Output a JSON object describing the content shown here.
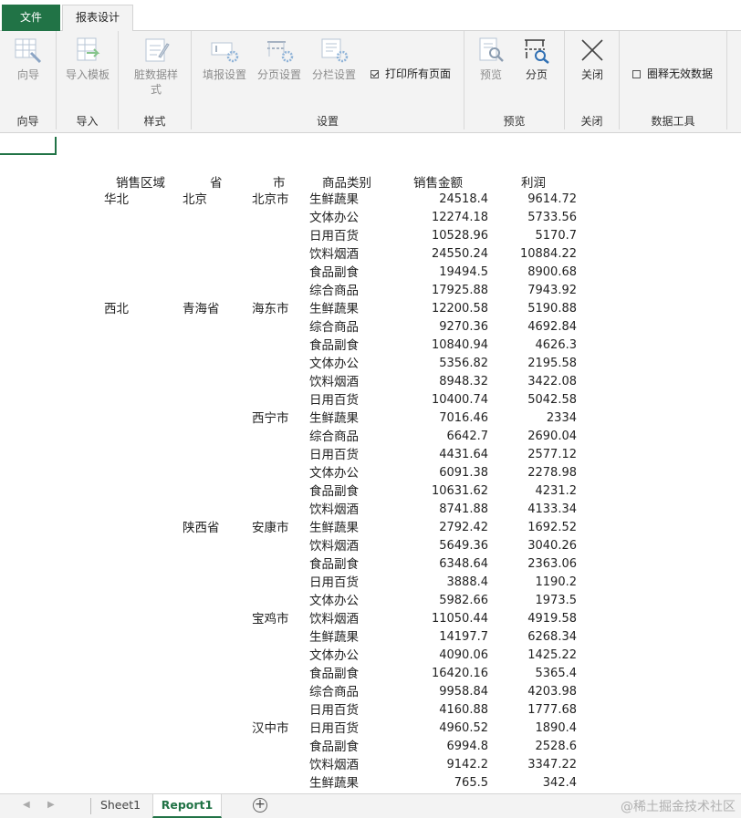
{
  "tabs": {
    "file": "文件",
    "active": "报表设计"
  },
  "ribbon": {
    "groups": {
      "wizard": "向导",
      "import": "导入",
      "style": "样式",
      "settings": "设置",
      "preview": "预览",
      "close": "关闭",
      "datatools": "数据工具"
    },
    "buttons": {
      "wizard": "向导",
      "import_template": "导入模板",
      "dirty_style_line1": "脏数据样",
      "dirty_style_line2": "式",
      "fill_settings": "填报设置",
      "page_settings": "分页设置",
      "column_settings": "分栏设置",
      "print_all": "打印所有页面",
      "preview": "预览",
      "paging": "分页",
      "close": "关闭",
      "circle_invalid": "圈释无效数据"
    }
  },
  "report": {
    "headers": {
      "region": "销售区域",
      "province": "省",
      "city": "市",
      "category": "商品类别",
      "sales": "销售金额",
      "profit": "利润"
    },
    "rows": [
      {
        "region": "华北",
        "province": "北京",
        "city": "北京市",
        "category": "生鲜蔬果",
        "sales": "24518.4",
        "profit": "9614.72"
      },
      {
        "region": "",
        "province": "",
        "city": "",
        "category": "文体办公",
        "sales": "12274.18",
        "profit": "5733.56"
      },
      {
        "region": "",
        "province": "",
        "city": "",
        "category": "日用百货",
        "sales": "10528.96",
        "profit": "5170.7"
      },
      {
        "region": "",
        "province": "",
        "city": "",
        "category": "饮料烟酒",
        "sales": "24550.24",
        "profit": "10884.22"
      },
      {
        "region": "",
        "province": "",
        "city": "",
        "category": "食品副食",
        "sales": "19494.5",
        "profit": "8900.68"
      },
      {
        "region": "",
        "province": "",
        "city": "",
        "category": "综合商品",
        "sales": "17925.88",
        "profit": "7943.92"
      },
      {
        "region": "西北",
        "province": "青海省",
        "city": "海东市",
        "category": "生鲜蔬果",
        "sales": "12200.58",
        "profit": "5190.88"
      },
      {
        "region": "",
        "province": "",
        "city": "",
        "category": "综合商品",
        "sales": "9270.36",
        "profit": "4692.84"
      },
      {
        "region": "",
        "province": "",
        "city": "",
        "category": "食品副食",
        "sales": "10840.94",
        "profit": "4626.3"
      },
      {
        "region": "",
        "province": "",
        "city": "",
        "category": "文体办公",
        "sales": "5356.82",
        "profit": "2195.58"
      },
      {
        "region": "",
        "province": "",
        "city": "",
        "category": "饮料烟酒",
        "sales": "8948.32",
        "profit": "3422.08"
      },
      {
        "region": "",
        "province": "",
        "city": "",
        "category": "日用百货",
        "sales": "10400.74",
        "profit": "5042.58"
      },
      {
        "region": "",
        "province": "",
        "city": "西宁市",
        "category": "生鲜蔬果",
        "sales": "7016.46",
        "profit": "2334"
      },
      {
        "region": "",
        "province": "",
        "city": "",
        "category": "综合商品",
        "sales": "6642.7",
        "profit": "2690.04"
      },
      {
        "region": "",
        "province": "",
        "city": "",
        "category": "日用百货",
        "sales": "4431.64",
        "profit": "2577.12"
      },
      {
        "region": "",
        "province": "",
        "city": "",
        "category": "文体办公",
        "sales": "6091.38",
        "profit": "2278.98"
      },
      {
        "region": "",
        "province": "",
        "city": "",
        "category": "食品副食",
        "sales": "10631.62",
        "profit": "4231.2"
      },
      {
        "region": "",
        "province": "",
        "city": "",
        "category": "饮料烟酒",
        "sales": "8741.88",
        "profit": "4133.34"
      },
      {
        "region": "",
        "province": "陕西省",
        "city": "安康市",
        "category": "生鲜蔬果",
        "sales": "2792.42",
        "profit": "1692.52"
      },
      {
        "region": "",
        "province": "",
        "city": "",
        "category": "饮料烟酒",
        "sales": "5649.36",
        "profit": "3040.26"
      },
      {
        "region": "",
        "province": "",
        "city": "",
        "category": "食品副食",
        "sales": "6348.64",
        "profit": "2363.06"
      },
      {
        "region": "",
        "province": "",
        "city": "",
        "category": "日用百货",
        "sales": "3888.4",
        "profit": "1190.2"
      },
      {
        "region": "",
        "province": "",
        "city": "",
        "category": "文体办公",
        "sales": "5982.66",
        "profit": "1973.5"
      },
      {
        "region": "",
        "province": "",
        "city": "宝鸡市",
        "category": "饮料烟酒",
        "sales": "11050.44",
        "profit": "4919.58"
      },
      {
        "region": "",
        "province": "",
        "city": "",
        "category": "生鲜蔬果",
        "sales": "14197.7",
        "profit": "6268.34"
      },
      {
        "region": "",
        "province": "",
        "city": "",
        "category": "文体办公",
        "sales": "4090.06",
        "profit": "1425.22"
      },
      {
        "region": "",
        "province": "",
        "city": "",
        "category": "食品副食",
        "sales": "16420.16",
        "profit": "5365.4"
      },
      {
        "region": "",
        "province": "",
        "city": "",
        "category": "综合商品",
        "sales": "9958.84",
        "profit": "4203.98"
      },
      {
        "region": "",
        "province": "",
        "city": "",
        "category": "日用百货",
        "sales": "4160.88",
        "profit": "1777.68"
      },
      {
        "region": "",
        "province": "",
        "city": "汉中市",
        "category": "日用百货",
        "sales": "4960.52",
        "profit": "1890.4"
      },
      {
        "region": "",
        "province": "",
        "city": "",
        "category": "食品副食",
        "sales": "6994.8",
        "profit": "2528.6"
      },
      {
        "region": "",
        "province": "",
        "city": "",
        "category": "饮料烟酒",
        "sales": "9142.2",
        "profit": "3347.22"
      },
      {
        "region": "",
        "province": "",
        "city": "",
        "category": "生鲜蔬果",
        "sales": "765.5",
        "profit": "342.4"
      }
    ]
  },
  "sheets": [
    "Sheet1",
    "Report1"
  ],
  "active_sheet": "Report1",
  "watermark": "@稀土掘金技术社区",
  "colors": {
    "accent": "#217346",
    "ribbon_bg": "#f3f3f3",
    "disabled_text": "#8c8c8c"
  }
}
